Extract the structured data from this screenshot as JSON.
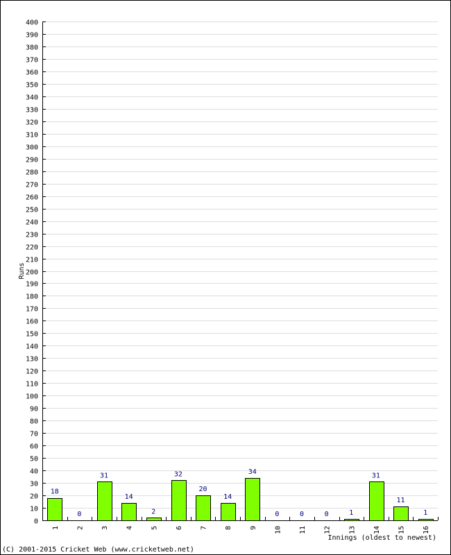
{
  "chart_data": {
    "type": "bar",
    "title": "",
    "xlabel": "Innings (oldest to newest)",
    "ylabel": "Runs",
    "ylim": [
      0,
      400
    ],
    "ytick_step": 10,
    "grid": true,
    "categories": [
      "1",
      "2",
      "3",
      "4",
      "5",
      "6",
      "7",
      "8",
      "9",
      "10",
      "11",
      "12",
      "13",
      "14",
      "15",
      "16"
    ],
    "values": [
      18,
      0,
      31,
      14,
      2,
      32,
      20,
      14,
      34,
      0,
      0,
      0,
      1,
      31,
      11,
      1
    ],
    "bar_color": "#80ff00",
    "label_color": "#000080",
    "grid_color": "#dddddd"
  },
  "footer": {
    "copyright": "(C) 2001-2015 Cricket Web (www.cricketweb.net)"
  }
}
